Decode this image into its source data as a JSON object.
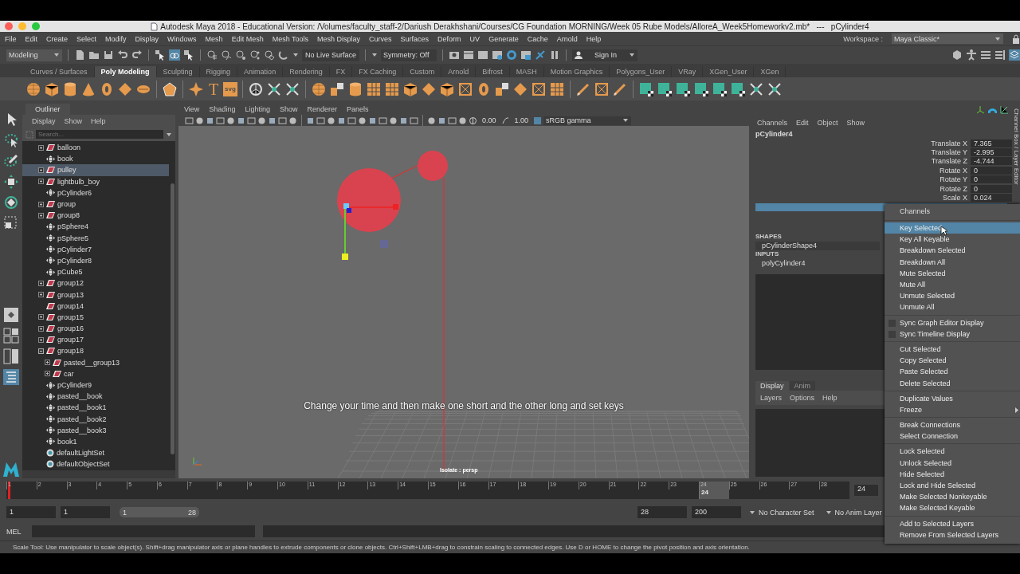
{
  "window": {
    "title": "Autodesk Maya 2018 - Educational Version: /Volumes/faculty_staff-2/Dariush Derakhshani/Courses/CG Foundation MORNING/Week 05 Rube Models/AlloreA_Week5Homeworkv2.mb*   ---   pCylinder4"
  },
  "menubar": {
    "items": [
      "File",
      "Edit",
      "Create",
      "Select",
      "Modify",
      "Display",
      "Windows",
      "Mesh",
      "Edit Mesh",
      "Mesh Tools",
      "Mesh Display",
      "Curves",
      "Surfaces",
      "Deform",
      "UV",
      "Generate",
      "Cache",
      "Arnold",
      "Help"
    ],
    "workspace_label": "Workspace :",
    "workspace": "Maya Classic*"
  },
  "toolbar": {
    "mode": "Modeling",
    "live_surface": "No Live Surface",
    "symmetry": "Symmetry: Off",
    "sign_in": "Sign In"
  },
  "shelf": {
    "tabs": [
      {
        "label": "Curves / Surfaces",
        "selected": false
      },
      {
        "label": "Poly Modeling",
        "selected": true
      },
      {
        "label": "Sculpting",
        "selected": false
      },
      {
        "label": "Rigging",
        "selected": false
      },
      {
        "label": "Animation",
        "selected": false
      },
      {
        "label": "Rendering",
        "selected": false
      },
      {
        "label": "FX",
        "selected": false
      },
      {
        "label": "FX Caching",
        "selected": false
      },
      {
        "label": "Custom",
        "selected": false
      },
      {
        "label": "Arnold",
        "selected": false
      },
      {
        "label": "Bifrost",
        "selected": false
      },
      {
        "label": "MASH",
        "selected": false
      },
      {
        "label": "Motion Graphics",
        "selected": false
      },
      {
        "label": "Polygons_User",
        "selected": false
      },
      {
        "label": "VRay",
        "selected": false
      },
      {
        "label": "XGen_User",
        "selected": false
      },
      {
        "label": "XGen",
        "selected": false
      }
    ],
    "text_icons": [
      "T",
      "svg"
    ]
  },
  "outliner": {
    "title": "Outliner",
    "menus": [
      "Display",
      "Show",
      "Help"
    ],
    "search": {
      "placeholder": "Search..."
    },
    "items": [
      {
        "label": "balloon",
        "kind": "group",
        "expanded": false,
        "selected": false
      },
      {
        "label": "book",
        "kind": "mesh",
        "selected": false
      },
      {
        "label": "pulley",
        "kind": "group",
        "expanded": false,
        "selected": true
      },
      {
        "label": "lightbulb_boy",
        "kind": "group",
        "expanded": false,
        "selected": false
      },
      {
        "label": "pCylinder6",
        "kind": "mesh",
        "selected": false
      },
      {
        "label": "group",
        "kind": "group",
        "expanded": false,
        "selected": false
      },
      {
        "label": "group8",
        "kind": "group",
        "expanded": false,
        "selected": false
      },
      {
        "label": "pSphere4",
        "kind": "mesh",
        "selected": false
      },
      {
        "label": "pSphere5",
        "kind": "mesh",
        "selected": false
      },
      {
        "label": "pCylinder7",
        "kind": "mesh",
        "selected": false
      },
      {
        "label": "pCylinder8",
        "kind": "mesh",
        "selected": false
      },
      {
        "label": "pCube5",
        "kind": "mesh",
        "selected": false
      },
      {
        "label": "group12",
        "kind": "group",
        "expanded": false,
        "selected": false
      },
      {
        "label": "group13",
        "kind": "group",
        "expanded": false,
        "selected": false
      },
      {
        "label": "group14",
        "kind": "group",
        "selected": false
      },
      {
        "label": "group15",
        "kind": "group",
        "expanded": false,
        "selected": false
      },
      {
        "label": "group16",
        "kind": "group",
        "expanded": false,
        "selected": false
      },
      {
        "label": "group17",
        "kind": "group",
        "expanded": false,
        "selected": false
      },
      {
        "label": "group18",
        "kind": "group",
        "expanded": true,
        "selected": false,
        "children": [
          {
            "label": "pasted__group13",
            "kind": "group",
            "expanded": false,
            "selected": false
          },
          {
            "label": "car",
            "kind": "group",
            "expanded": false,
            "selected": false
          }
        ]
      },
      {
        "label": "pCylinder9",
        "kind": "mesh",
        "selected": false
      },
      {
        "label": "pasted__book",
        "kind": "mesh",
        "selected": false
      },
      {
        "label": "pasted__book1",
        "kind": "mesh",
        "selected": false
      },
      {
        "label": "pasted__book2",
        "kind": "mesh",
        "selected": false
      },
      {
        "label": "pasted__book3",
        "kind": "mesh",
        "selected": false
      },
      {
        "label": "book1",
        "kind": "mesh",
        "selected": false
      },
      {
        "label": "defaultLightSet",
        "kind": "set",
        "selected": false
      },
      {
        "label": "defaultObjectSet",
        "kind": "set",
        "selected": false
      }
    ]
  },
  "viewport": {
    "menus": [
      "View",
      "Shading",
      "Lighting",
      "Show",
      "Renderer",
      "Panels"
    ],
    "exposure": "0.00",
    "gamma": "1.00",
    "color_space": "sRGB gamma",
    "caption": "Change your time and then make one short and the other long and set keys",
    "camera_label": "Isolate : persp"
  },
  "channel_box": {
    "menus": [
      "Channels",
      "Edit",
      "Object",
      "Show"
    ],
    "object": "pCylinder4",
    "side_tab": "Channel Box / Layer Editor",
    "attributes": [
      {
        "name": "Translate X",
        "value": "7.365"
      },
      {
        "name": "Translate Y",
        "value": "-2.995"
      },
      {
        "name": "Translate Z",
        "value": "-4.744"
      },
      {
        "name": "Rotate X",
        "value": "0"
      },
      {
        "name": "Rotate Y",
        "value": "0"
      },
      {
        "name": "Rotate Z",
        "value": "0"
      },
      {
        "name": "Scale X",
        "value": "0.024"
      }
    ],
    "shapes_heading": "SHAPES",
    "shapes": [
      "pCylinderShape4"
    ],
    "inputs_heading": "INPUTS",
    "inputs": [
      "polyCylinder4"
    ],
    "layer_tabs": [
      {
        "label": "Display",
        "selected": true
      },
      {
        "label": "Anim",
        "selected": false
      }
    ],
    "layer_menus": [
      "Layers",
      "Options",
      "Help"
    ]
  },
  "context_menu": {
    "heading": "Channels",
    "groups": [
      [
        {
          "label": "Key Selected",
          "kind": "action",
          "selected": true
        },
        {
          "label": "Key All Keyable",
          "kind": "action",
          "selected": false
        },
        {
          "label": "Breakdown Selected",
          "kind": "action",
          "selected": false
        },
        {
          "label": "Breakdown All",
          "kind": "action",
          "selected": false
        },
        {
          "label": "Mute Selected",
          "kind": "action",
          "selected": false
        },
        {
          "label": "Mute All",
          "kind": "action",
          "selected": false
        },
        {
          "label": "Unmute Selected",
          "kind": "action",
          "selected": false
        },
        {
          "label": "Unmute All",
          "kind": "action",
          "selected": false
        }
      ],
      [
        {
          "label": "Sync Graph Editor Display",
          "kind": "check",
          "checked": false,
          "selected": false
        },
        {
          "label": "Sync Timeline Display",
          "kind": "check",
          "checked": false,
          "selected": false
        }
      ],
      [
        {
          "label": "Cut Selected",
          "kind": "action",
          "selected": false
        },
        {
          "label": "Copy Selected",
          "kind": "action",
          "selected": false
        },
        {
          "label": "Paste Selected",
          "kind": "action",
          "selected": false
        },
        {
          "label": "Delete Selected",
          "kind": "action",
          "selected": false
        }
      ],
      [
        {
          "label": "Duplicate Values",
          "kind": "action",
          "selected": false
        },
        {
          "label": "Freeze",
          "kind": "submenu",
          "selected": false
        }
      ],
      [
        {
          "label": "Break Connections",
          "kind": "action",
          "selected": false
        },
        {
          "label": "Select Connection",
          "kind": "action",
          "selected": false
        }
      ],
      [
        {
          "label": "Lock Selected",
          "kind": "action",
          "selected": false
        },
        {
          "label": "Unlock Selected",
          "kind": "action",
          "selected": false
        },
        {
          "label": "Hide Selected",
          "kind": "action",
          "selected": false
        },
        {
          "label": "Lock and Hide Selected",
          "kind": "action",
          "selected": false
        },
        {
          "label": "Make Selected Nonkeyable",
          "kind": "action",
          "selected": false
        },
        {
          "label": "Make Selected Keyable",
          "kind": "action",
          "selected": false
        }
      ],
      [
        {
          "label": "Add to Selected Layers",
          "kind": "action",
          "selected": false
        },
        {
          "label": "Remove From Selected Layers",
          "kind": "action",
          "selected": false
        }
      ]
    ]
  },
  "timeline": {
    "frames": [
      {
        "label": "1",
        "selected": false
      },
      {
        "label": "2",
        "selected": false
      },
      {
        "label": "3",
        "selected": false
      },
      {
        "label": "4",
        "selected": false
      },
      {
        "label": "5",
        "selected": false
      },
      {
        "label": "6",
        "selected": false
      },
      {
        "label": "7",
        "selected": false
      },
      {
        "label": "8",
        "selected": false
      },
      {
        "label": "9",
        "selected": false
      },
      {
        "label": "10",
        "selected": false
      },
      {
        "label": "11",
        "selected": false
      },
      {
        "label": "12",
        "selected": false
      },
      {
        "label": "13",
        "selected": false
      },
      {
        "label": "14",
        "selected": false
      },
      {
        "label": "15",
        "selected": false
      },
      {
        "label": "16",
        "selected": false
      },
      {
        "label": "17",
        "selected": false
      },
      {
        "label": "18",
        "selected": false
      },
      {
        "label": "19",
        "selected": false
      },
      {
        "label": "20",
        "selected": false
      },
      {
        "label": "21",
        "selected": false
      },
      {
        "label": "22",
        "selected": false
      },
      {
        "label": "23",
        "selected": false
      },
      {
        "label": "24",
        "selected": true
      },
      {
        "label": "25",
        "selected": false
      },
      {
        "label": "26",
        "selected": false
      },
      {
        "label": "27",
        "selected": false
      },
      {
        "label": "28",
        "selected": false
      }
    ],
    "hover_label": "24",
    "current_frame": "24"
  },
  "range": {
    "level": 1,
    "start": "1",
    "playback_start": "1",
    "slider_start": "1",
    "slider_end": "28",
    "playback_end": "28",
    "end": "200",
    "character_set": "No Character Set",
    "anim_layer": "No Anim Layer"
  },
  "command_line": {
    "label": "MEL"
  },
  "help_line": "Scale Tool: Use manipulator to scale object(s). Shift+drag manipulator axis or plane handles to extrude components or clone objects. Ctrl+Shift+LMB+drag to constrain scaling to connected edges. Use D or HOME to change the pivot position and axis orientation."
}
